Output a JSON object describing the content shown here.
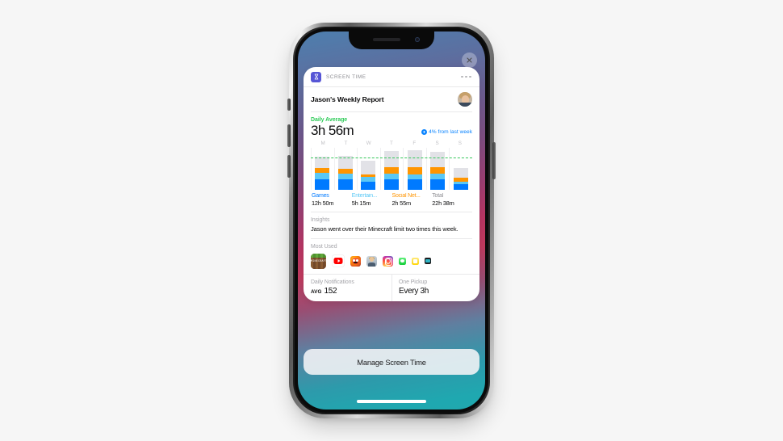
{
  "device": {
    "type": "smartphone-mockup",
    "wallpaper_colors": [
      "#4d7fae",
      "#9b3f72",
      "#c03a5e",
      "#20a7ae"
    ]
  },
  "close_button": {
    "icon": "close-icon",
    "label": ""
  },
  "notification": {
    "app_icon": "hourglass-icon",
    "app_name": "SCREEN TIME",
    "more_icon": "ellipsis-icon",
    "report_title": "Jason's Weekly Report",
    "avatar": "avatar",
    "summary": {
      "label": "Daily Average",
      "value_hours": "3h",
      "value_minutes": "56m",
      "value_full": "3h 56m",
      "trend_icon": "arrow-up-circle-icon",
      "trend_text": "4% from last week",
      "trend_color": "#0a84ff",
      "label_color": "#2ecb58"
    },
    "insights": {
      "label": "Insights",
      "text": "Jason went over their Minecraft limit two times this week."
    },
    "most_used": {
      "label": "Most Used",
      "apps": [
        {
          "name": "Minecraft",
          "icon": "minecraft-icon",
          "size": "s1"
        },
        {
          "name": "YouTube",
          "icon": "youtube-icon",
          "size": "s2"
        },
        {
          "name": "Crash Bandicoot",
          "icon": "game-icon",
          "size": "s3"
        },
        {
          "name": "Photos",
          "icon": "photo-app-icon",
          "size": "s3"
        },
        {
          "name": "Instagram",
          "icon": "instagram-icon",
          "size": "s3"
        },
        {
          "name": "Messages",
          "icon": "messages-icon",
          "size": "s4"
        },
        {
          "name": "Notes",
          "icon": "notes-icon",
          "size": "s4"
        },
        {
          "name": "Settings",
          "icon": "dark-app-icon",
          "size": "s5"
        }
      ]
    },
    "stats": [
      {
        "label": "Daily Notifications",
        "prefix": "AVG",
        "value": "152"
      },
      {
        "label": "One Pickup",
        "prefix": "",
        "value": "Every 3h"
      }
    ]
  },
  "manage_button": {
    "label": "Manage Screen Time"
  },
  "chart_data": {
    "type": "bar",
    "stacked": true,
    "title": "Daily Average",
    "xlabel": "",
    "ylabel": "",
    "grid": false,
    "legend_position": "bottom",
    "categories": [
      "M",
      "T",
      "W",
      "T",
      "F",
      "S",
      "S"
    ],
    "series": [
      {
        "name": "Games",
        "color": "#007aff",
        "total": "12h 50m",
        "values": [
          26,
          26,
          20,
          26,
          26,
          26,
          15
        ]
      },
      {
        "name": "Entertain...",
        "color": "#5ac8f5",
        "total": "5h 15m",
        "values": [
          15,
          14,
          11,
          14,
          12,
          13,
          5
        ]
      },
      {
        "name": "Social Net...",
        "color": "#ff9500",
        "total": "2h 55m",
        "values": [
          11,
          11,
          6,
          14,
          16,
          15,
          9
        ]
      },
      {
        "name": "Remaining",
        "color": "#e2e2e7",
        "total": "",
        "values": [
          28,
          30,
          34,
          40,
          42,
          37,
          23
        ]
      }
    ],
    "legend": [
      {
        "label": "Games",
        "value": "12h 50m",
        "color": "#007aff"
      },
      {
        "label": "Entertain...",
        "value": "5h 15m",
        "color": "#5ac8f5"
      },
      {
        "label": "Social Net...",
        "value": "2h 55m",
        "color": "#ff9500"
      },
      {
        "label": "Total",
        "value": "22h 38m",
        "color": "#8e8e93"
      }
    ],
    "limit_line": {
      "value": 76,
      "color": "#34c759",
      "style": "dashed"
    },
    "ylim": [
      0,
      100
    ]
  }
}
